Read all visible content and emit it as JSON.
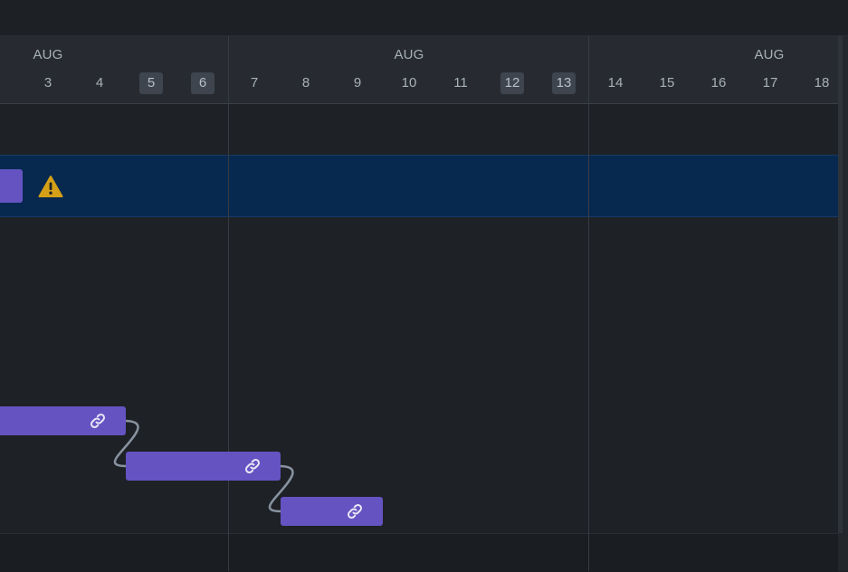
{
  "timeline": {
    "weeks": [
      {
        "month": "AUG",
        "days": [
          {
            "label": "3",
            "weekend": false
          },
          {
            "label": "4",
            "weekend": false
          },
          {
            "label": "5",
            "weekend": true
          },
          {
            "label": "6",
            "weekend": true
          }
        ]
      },
      {
        "month": "AUG",
        "days": [
          {
            "label": "7",
            "weekend": false
          },
          {
            "label": "8",
            "weekend": false
          },
          {
            "label": "9",
            "weekend": false
          },
          {
            "label": "10",
            "weekend": false
          },
          {
            "label": "11",
            "weekend": false
          },
          {
            "label": "12",
            "weekend": true
          },
          {
            "label": "13",
            "weekend": true
          }
        ]
      },
      {
        "month": "AUG",
        "days": [
          {
            "label": "14",
            "weekend": false
          },
          {
            "label": "15",
            "weekend": false
          },
          {
            "label": "16",
            "weekend": false
          },
          {
            "label": "17",
            "weekend": false
          },
          {
            "label": "18",
            "weekend": false
          }
        ]
      }
    ]
  },
  "icons": {
    "warning": "warning-icon",
    "link": "link-icon"
  },
  "colors": {
    "task_bar": "#6553c2",
    "selected_row": "#07294f",
    "warning": "#d4a017",
    "connector": "#8892a0"
  }
}
